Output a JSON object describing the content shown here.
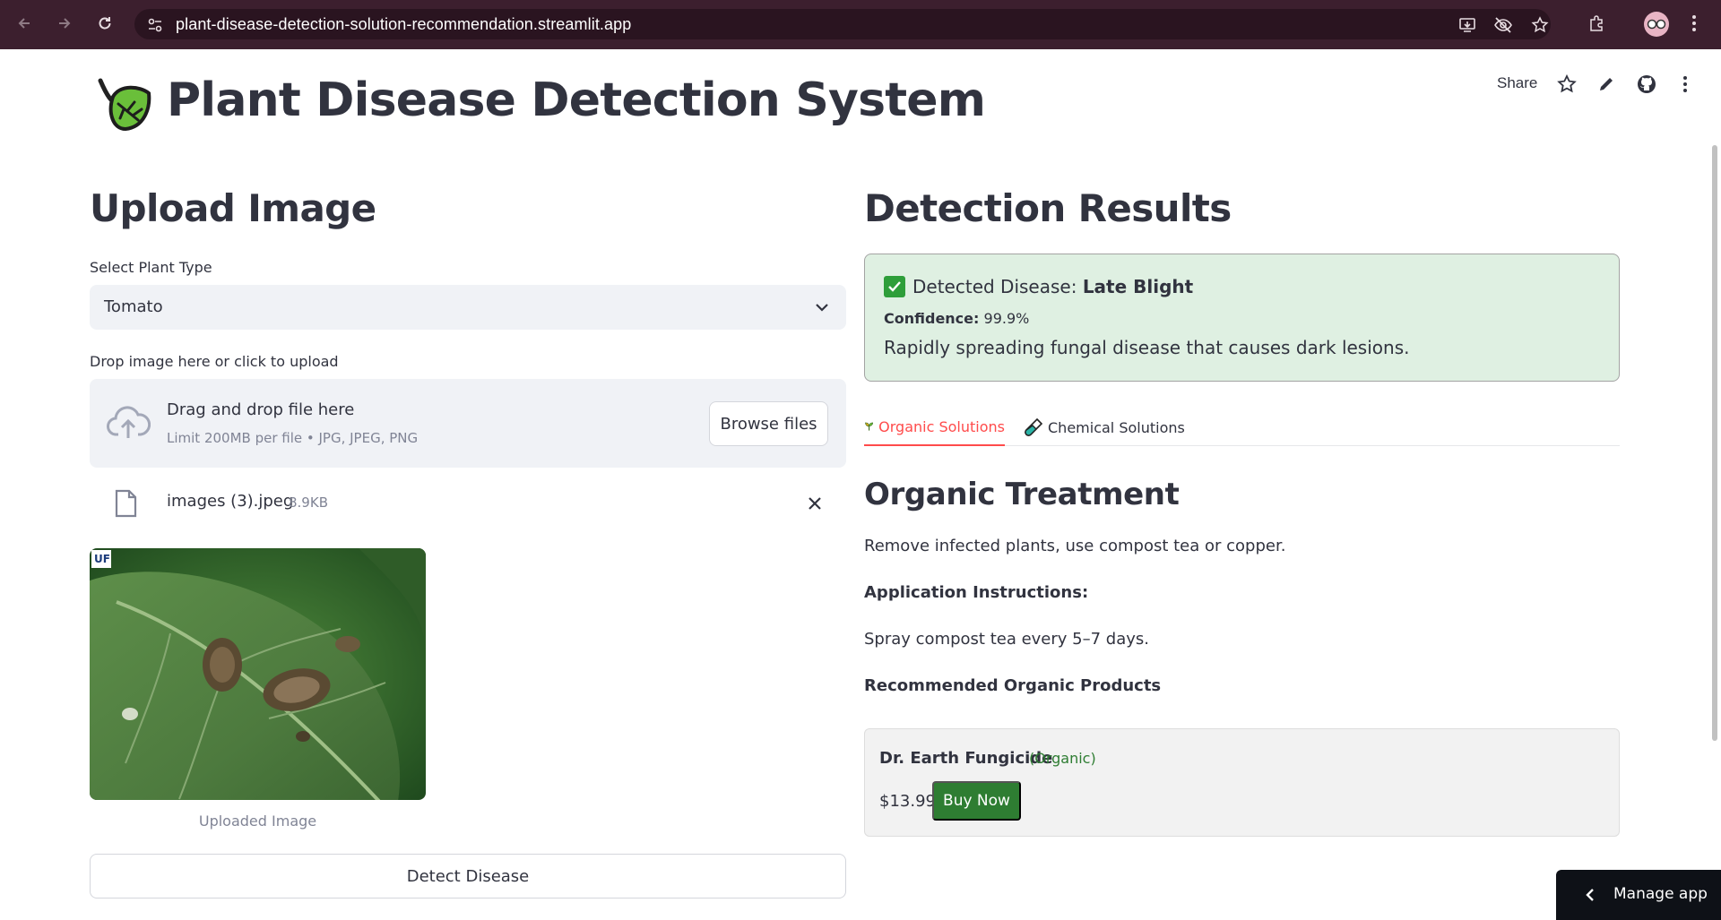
{
  "browser": {
    "url": "plant-disease-detection-solution-recommendation.streamlit.app"
  },
  "toolbar": {
    "share_label": "Share"
  },
  "header": {
    "title": "Plant Disease Detection System"
  },
  "upload": {
    "heading": "Upload Image",
    "plant_type_label": "Select Plant Type",
    "plant_type_value": "Tomato",
    "dropzone_label": "Drop image here or click to upload",
    "dropzone_title": "Drag and drop file here",
    "dropzone_limit": "Limit 200MB per file • JPG, JPEG, PNG",
    "browse_label": "Browse files",
    "file_name": "images (3).jpeg",
    "file_size": "8.9KB",
    "image_caption": "Uploaded Image",
    "detect_label": "Detect Disease"
  },
  "results": {
    "heading": "Detection Results",
    "detected_prefix": "Detected Disease: ",
    "detected_value": "Late Blight",
    "confidence_label": "Confidence:",
    "confidence_value": "99.9%",
    "description": "Rapidly spreading fungal disease that causes dark lesions.",
    "tabs": [
      {
        "label": "Organic Solutions",
        "icon": "seedling-icon"
      },
      {
        "label": "Chemical Solutions",
        "icon": "test-tube-icon"
      }
    ],
    "treatment_heading": "Organic Treatment",
    "treatment_text": "Remove infected plants, use compost tea or copper.",
    "instructions_label": "Application Instructions:",
    "instructions_text": "Spray compost tea every 5–7 days.",
    "products_label": "Recommended Organic Products",
    "product": {
      "name": "Dr. Earth Fungicide",
      "tag": "(Organic)",
      "price": "$13.99",
      "buy_label": "Buy Now"
    }
  },
  "footer": {
    "manage_label": "Manage app"
  },
  "colors": {
    "chrome_bg": "#3c1f2e",
    "accent": "#ff4b4b",
    "success_bg": "#dff0e2",
    "buy_green": "#2e7d32"
  }
}
